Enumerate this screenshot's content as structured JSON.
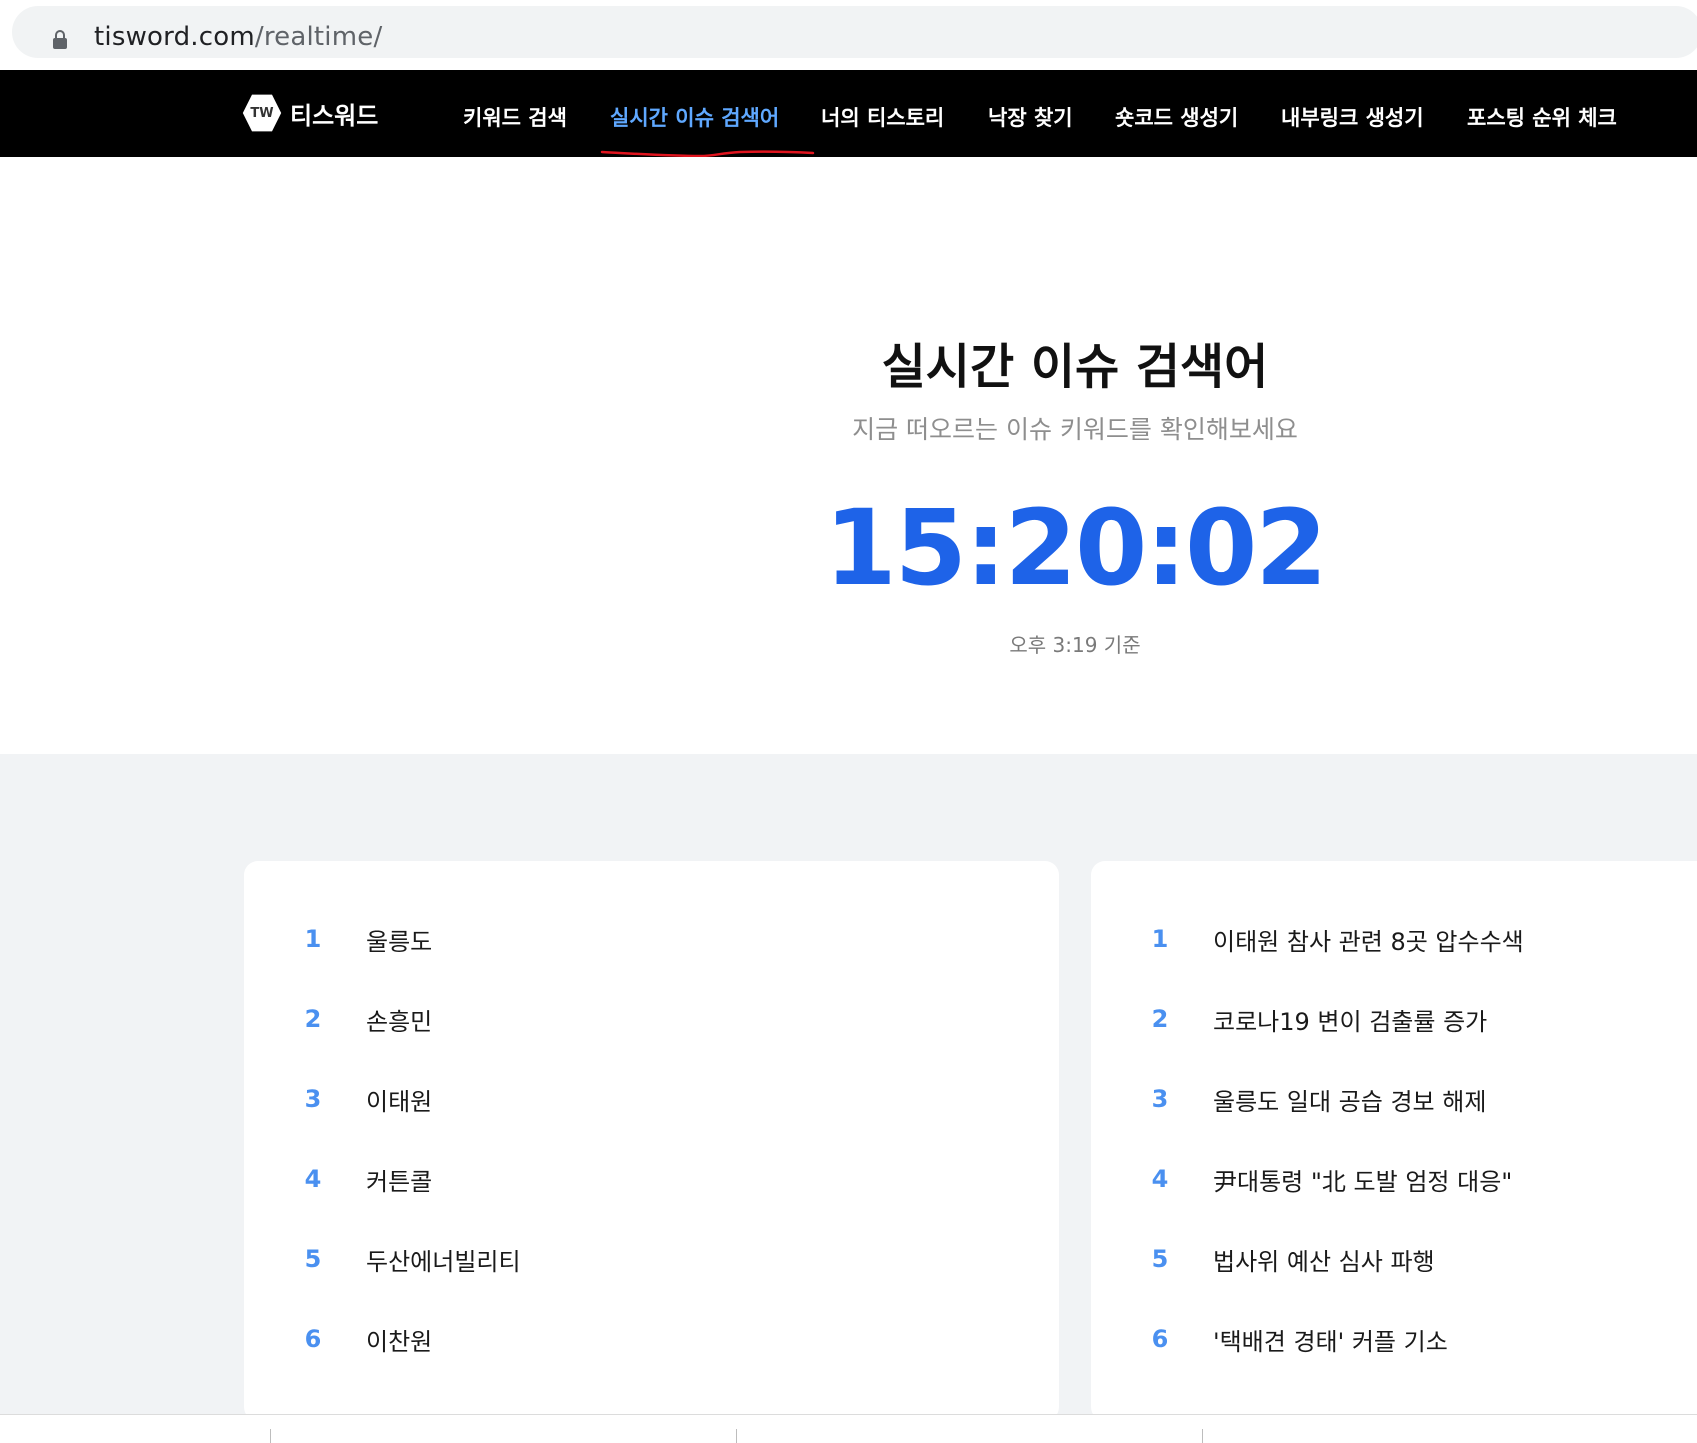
{
  "browser": {
    "url_domain": "tisword.com",
    "url_path": "/realtime/"
  },
  "nav": {
    "logo_mark": "TW",
    "logo_text": "티스워드",
    "items": [
      {
        "label": "키워드 검색"
      },
      {
        "label": "실시간 이슈 검색어",
        "active": true
      },
      {
        "label": "너의 티스토리"
      },
      {
        "label": "낙장 찾기"
      },
      {
        "label": "숏코드 생성기"
      },
      {
        "label": "내부링크 생성기"
      },
      {
        "label": "포스팅 순위 체크"
      }
    ]
  },
  "hero": {
    "title": "실시간 이슈 검색어",
    "subtitle": "지금 떠오르는 이슈 키워드를 확인해보세요",
    "clock": "15:20:02",
    "basis": "오후 3:19 기준"
  },
  "left_list": [
    {
      "rank": "1",
      "text": "울릉도"
    },
    {
      "rank": "2",
      "text": "손흥민"
    },
    {
      "rank": "3",
      "text": "이태원"
    },
    {
      "rank": "4",
      "text": "커튼콜"
    },
    {
      "rank": "5",
      "text": "두산에너빌리티"
    },
    {
      "rank": "6",
      "text": "이찬원"
    }
  ],
  "right_list": [
    {
      "rank": "1",
      "text": "이태원 참사 관련 8곳 압수수색"
    },
    {
      "rank": "2",
      "text": "코로나19 변이 검출률 증가"
    },
    {
      "rank": "3",
      "text": "울릉도 일대 공습 경보 해제"
    },
    {
      "rank": "4",
      "text": "尹대통령 \"北 도발 엄정 대응\""
    },
    {
      "rank": "5",
      "text": "법사위 예산 심사 파행"
    },
    {
      "rank": "6",
      "text": "'택배견 경태' 커플 기소"
    }
  ],
  "colors": {
    "accent": "#1e63e8",
    "rank_number": "#4a90f0",
    "nav_active": "#5fa8ff",
    "underline": "#e0141e"
  }
}
